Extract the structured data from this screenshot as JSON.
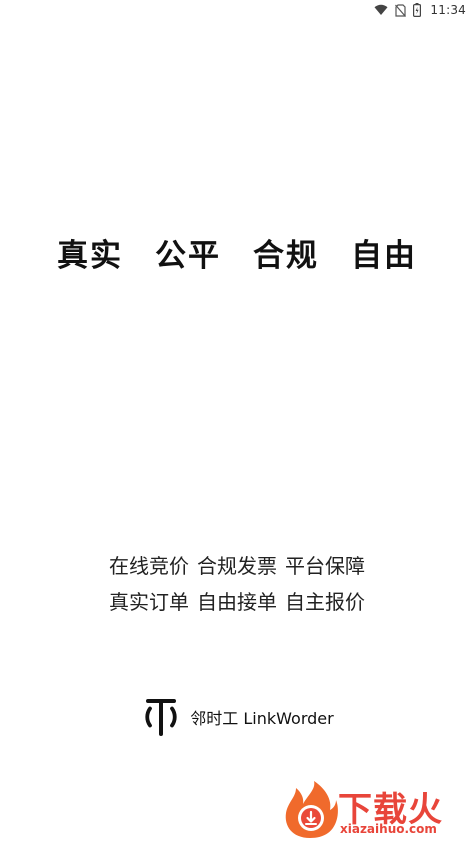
{
  "status_bar": {
    "time": "11:34",
    "icons": [
      "wifi-icon",
      "no-sim-icon",
      "battery-icon"
    ]
  },
  "slogan": [
    "真实",
    "公平",
    "合规",
    "自由"
  ],
  "features": {
    "line1": [
      "在线竞价",
      "合规发票",
      "平台保障"
    ],
    "line2": [
      "真实订单",
      "自由接单",
      "自主报价"
    ]
  },
  "brand": {
    "name": "邻时工 LinkWorder"
  },
  "watermark": {
    "text": "下载火",
    "domain": "xiazaihuo.com"
  },
  "colors": {
    "background": "#ffffff",
    "text": "#111111",
    "watermark": "#e8453a"
  }
}
